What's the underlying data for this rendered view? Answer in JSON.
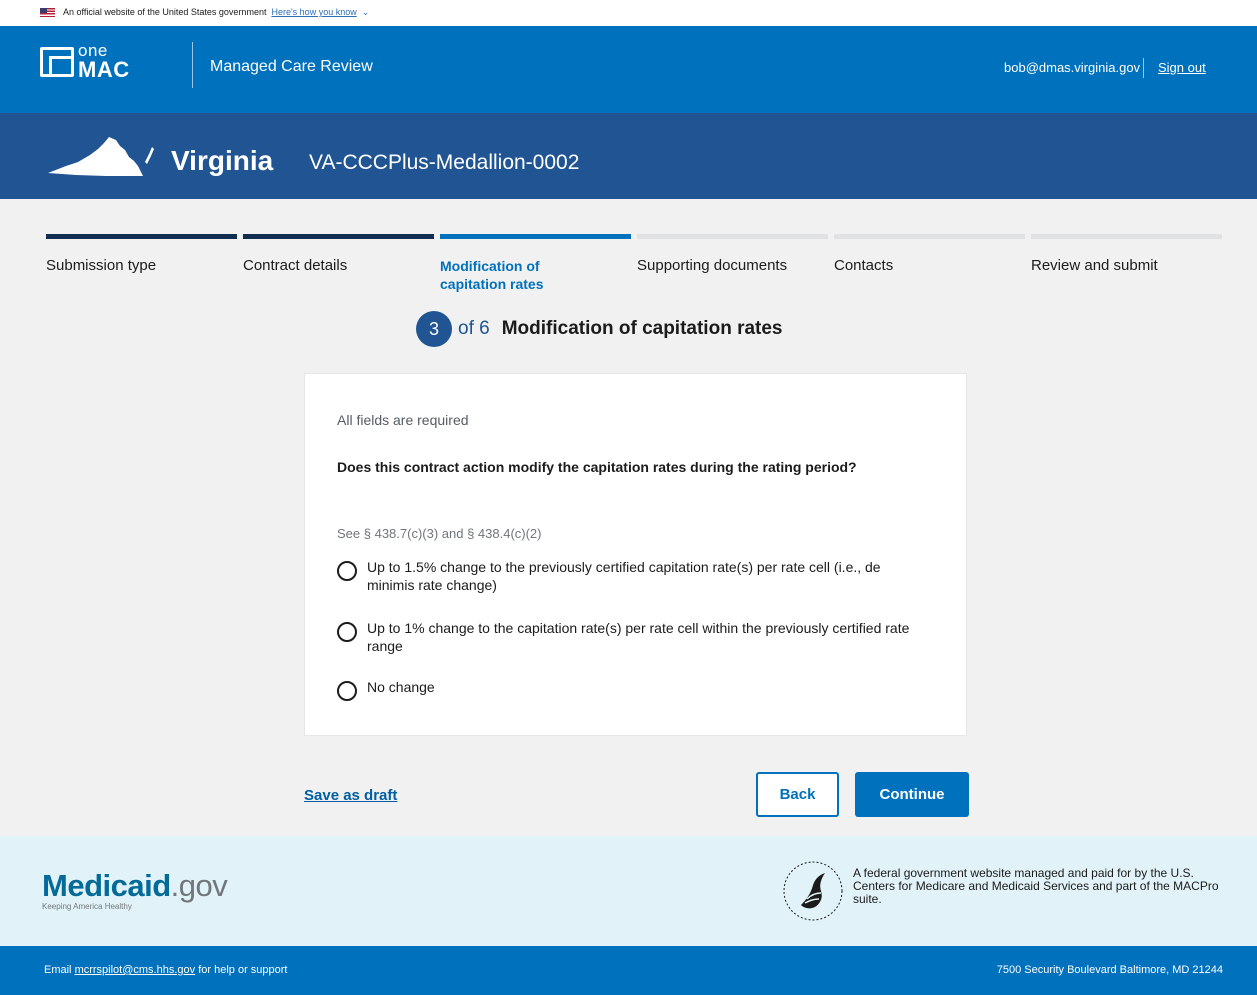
{
  "gov_banner": {
    "text": "An official website of the United States government",
    "link": "Here's how you know"
  },
  "header": {
    "logo_one": "one",
    "logo_mac": "MAC",
    "app_title": "Managed Care Review",
    "user_email": "bob@dmas.virginia.gov",
    "sign_out": "Sign out"
  },
  "state_banner": {
    "state": "Virginia",
    "submission_id": "VA-CCCPlus-Medallion-0002"
  },
  "steps": [
    {
      "label": "Submission type",
      "status": "complete"
    },
    {
      "label": "Contract details",
      "status": "complete"
    },
    {
      "label": "Modification of capitation rates",
      "status": "current"
    },
    {
      "label": "Supporting documents",
      "status": "upcoming"
    },
    {
      "label": "Contacts",
      "status": "upcoming"
    },
    {
      "label": "Review and submit",
      "status": "upcoming"
    }
  ],
  "step_heading": {
    "number": "3",
    "of": "of 6",
    "title": "Modification of capitation rates"
  },
  "form": {
    "required_note": "All fields are required",
    "question": "Does this contract action modify the capitation rates during the rating period?",
    "hint": "See § 438.7(c)(3) and § 438.4(c)(2)",
    "options": [
      {
        "label": "Up to 1.5% change to the previously certified capitation rate(s) per rate cell (i.e., de minimis rate change)",
        "selected": false
      },
      {
        "label": "Up to 1% change to the capitation rate(s) per rate cell within the previously certified rate range",
        "selected": false
      },
      {
        "label": "No change",
        "selected": false
      }
    ]
  },
  "actions": {
    "save_draft": "Save as draft",
    "back": "Back",
    "continue": "Continue"
  },
  "footer": {
    "medicaid_name": "Medicaid",
    "medicaid_domain": ".gov",
    "medicaid_tagline": "Keeping America Healthy",
    "federal_text": "A federal government website managed and paid for by the U.S. Centers for Medicare and Medicaid Services and part of the MACPro suite.",
    "help_prefix": "Email ",
    "help_email": "mcrrspilot@cms.hhs.gov",
    "help_suffix": " for help or support",
    "address": "7500 Security Boulevard Baltimore, MD 21244"
  },
  "colors": {
    "header_blue": "#0071bc",
    "state_banner_blue": "#205493",
    "step_complete": "#112e51",
    "step_upcoming": "#dfe1e2",
    "footer_light": "#e1f3f8"
  },
  "icons": {
    "flag": "us-flag-icon",
    "banner_chevron": "chevron-down-icon",
    "state": "virginia-state-icon",
    "seal": "hhs-seal-icon"
  }
}
